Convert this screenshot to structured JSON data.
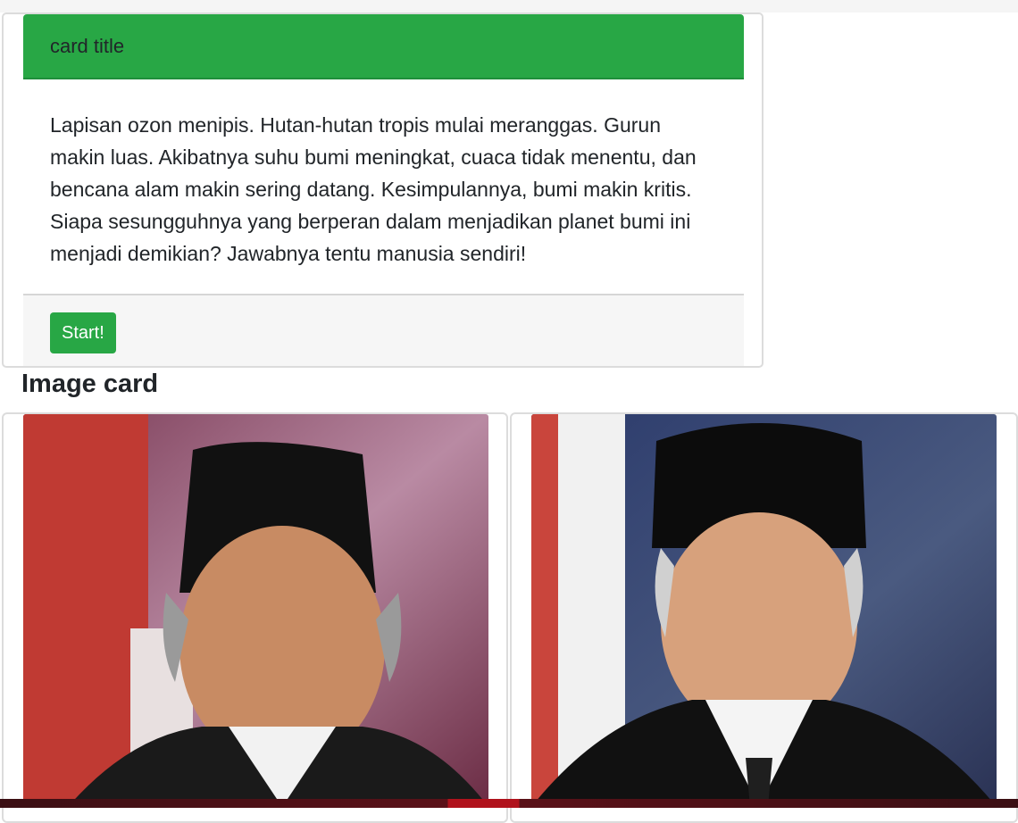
{
  "card": {
    "title": "card title",
    "body": "Lapisan ozon menipis. Hutan-hutan tropis mulai meranggas. Gurun makin luas. Akibatnya suhu bumi meningkat, cuaca tidak menentu, dan bencana alam makin sering datang. Kesimpulannya, bumi makin kritis. Siapa sesungguhnya yang berperan dalam menjadikan planet bumi ini menjadi demikian? Jawabnya tentu manusia sendiri!",
    "button_label": "Start!"
  },
  "section": {
    "title": "Image card"
  },
  "colors": {
    "accent": "#28a745",
    "footer_bg": "#f6f6f6"
  }
}
